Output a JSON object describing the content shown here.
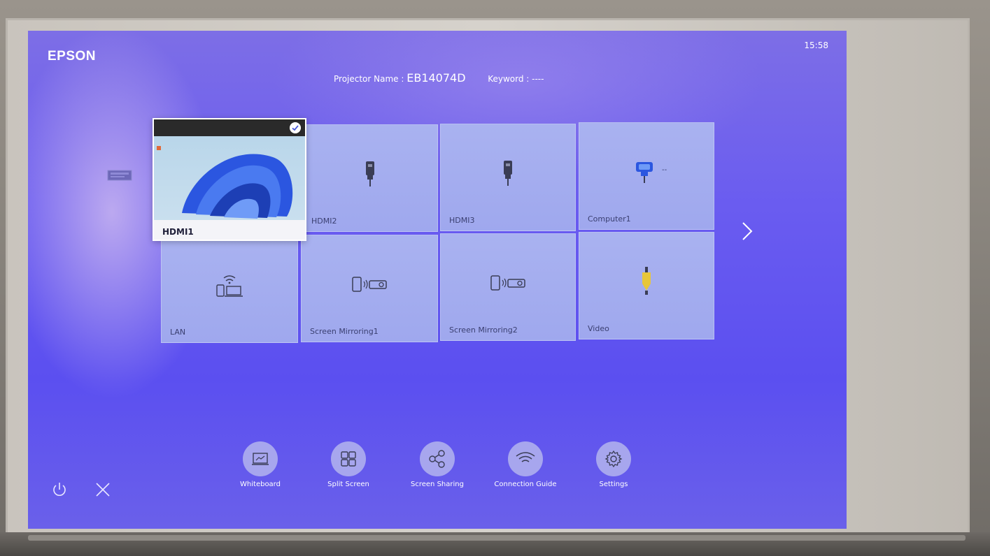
{
  "header": {
    "brand": "EPSON",
    "clock": "15:58",
    "projector_name_label": "Projector Name :",
    "projector_name": "EB14074D",
    "keyword_label": "Keyword :",
    "keyword": "----"
  },
  "sources": [
    {
      "label": "HDMI1",
      "icon": "windows-desktop-preview",
      "selected": true
    },
    {
      "label": "HDMI2",
      "icon": "hdmi-plug-icon"
    },
    {
      "label": "HDMI3",
      "icon": "hdmi-plug-icon"
    },
    {
      "label": "Computer1",
      "icon": "vga-plug-icon",
      "extra": "--"
    },
    {
      "label": "LAN",
      "icon": "lan-wifi-icon"
    },
    {
      "label": "Screen Mirroring1",
      "icon": "screen-mirroring-icon"
    },
    {
      "label": "Screen Mirroring2",
      "icon": "screen-mirroring-icon"
    },
    {
      "label": "Video",
      "icon": "rca-plug-icon"
    }
  ],
  "toolbar": [
    {
      "label": "Whiteboard",
      "icon": "whiteboard-icon"
    },
    {
      "label": "Split Screen",
      "icon": "split-screen-icon"
    },
    {
      "label": "Screen Sharing",
      "icon": "share-icon"
    },
    {
      "label": "Connection Guide",
      "icon": "wifi-icon"
    },
    {
      "label": "Settings",
      "icon": "gear-icon"
    }
  ],
  "corner_controls": [
    {
      "icon": "power-icon"
    },
    {
      "icon": "close-icon"
    }
  ],
  "colors": {
    "screen_bg": "#6a5cf0",
    "tile_bg": "#a9b2f0",
    "tile_label": "#3a3f70",
    "toolbar_circle": "#a7a6ee",
    "accent_blue": "#2b56e0",
    "rca_yellow": "#e8c63a"
  }
}
